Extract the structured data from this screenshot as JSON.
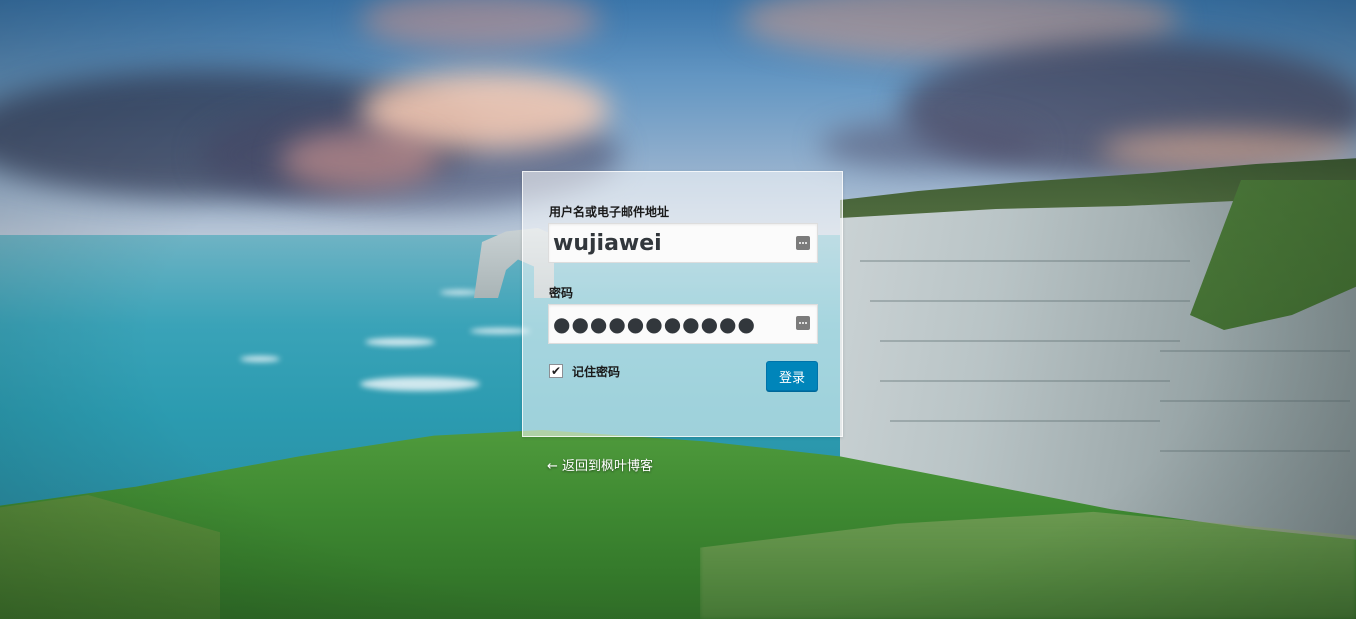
{
  "login_form": {
    "username_label": "用户名或电子邮件地址",
    "username_value": "wujiawei",
    "password_label": "密码",
    "password_value": "●●●●●●●●●●●",
    "remember_label": "记住密码",
    "remember_checked": true,
    "remember_check_glyph": "✔",
    "submit_label": "登录"
  },
  "back_link": {
    "text": "← 返回到枫叶博客"
  },
  "colors": {
    "primary_button": "#0085ba",
    "panel_background": "rgba(255,255,255,0.55)"
  },
  "icons": {
    "field_icon": "password-manager-key-icon"
  }
}
